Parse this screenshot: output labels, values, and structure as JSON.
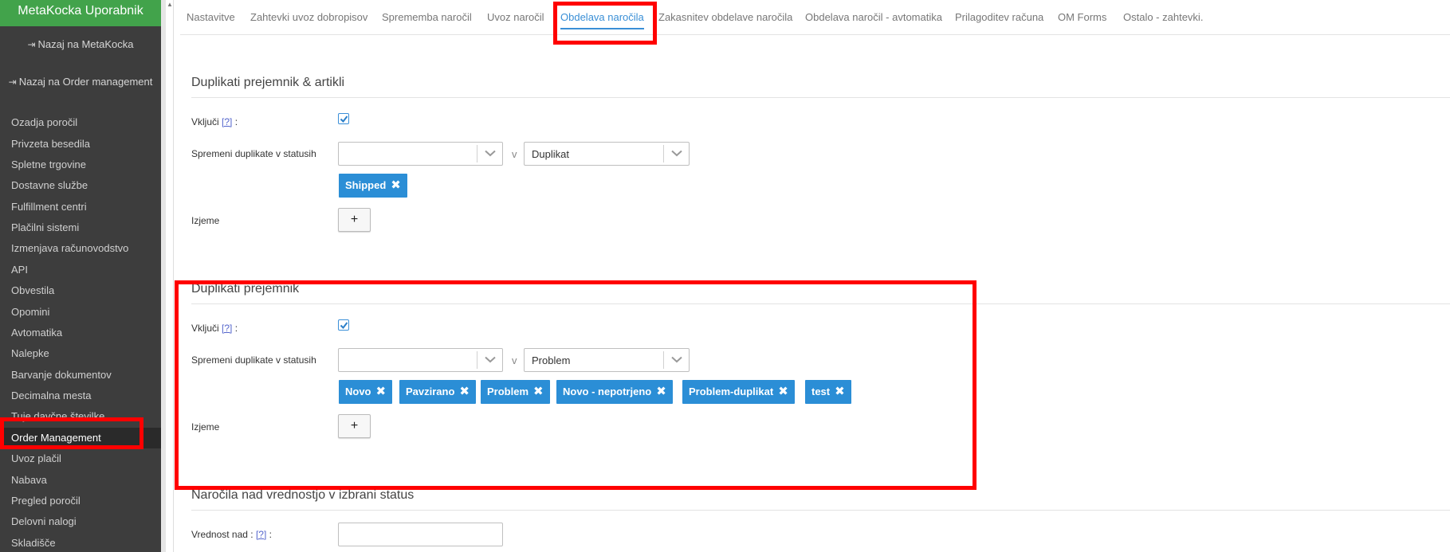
{
  "sidebar": {
    "title": "MetaKocka Uporabnik",
    "back_links": [
      "Nazaj na MetaKocka",
      "Nazaj na Order management"
    ],
    "items": [
      "Ozadja poročil",
      "Privzeta besedila",
      "Spletne trgovine",
      "Dostavne službe",
      "Fulfillment centri",
      "Plačilni sistemi",
      "Izmenjava računovodstvo",
      "API",
      "Obvestila",
      "Opomini",
      "Avtomatika",
      "Nalepke",
      "Barvanje dokumentov",
      "Decimalna mesta",
      "Tuje davčne številke",
      "Order Management",
      "Uvoz plačil",
      "Nabava",
      "Pregled poročil",
      "Delovni nalogi",
      "Skladišče"
    ],
    "active_item": "Order Management"
  },
  "tabs": [
    "Nastavitve",
    "Zahtevki uvoz dobropisov",
    "Sprememba naročil",
    "Uvoz naročil",
    "Obdelava naročila",
    "Zakasnitev obdelave naročila",
    "Obdelava naročil - avtomatika",
    "Prilagoditev računa",
    "OM Forms",
    "Ostalo - zahtevki."
  ],
  "active_tab": "Obdelava naročila",
  "sections": [
    {
      "title": "Duplikati prejemnik & artikli",
      "enable_label": "Vključi",
      "help": "[?]",
      "colon": ":",
      "enabled": true,
      "change_label": "Spremeni duplikate v statusih",
      "from_value": "",
      "v": "v",
      "to_value": "Duplikat",
      "tags": [
        "Shipped"
      ],
      "exceptions_label": "Izjeme",
      "add_label": "+"
    },
    {
      "title": "Duplikati prejemnik",
      "enable_label": "Vključi",
      "help": "[?]",
      "colon": ":",
      "enabled": true,
      "change_label": "Spremeni duplikate v statusih",
      "from_value": "",
      "v": "v",
      "to_value": "Problem",
      "tags": [
        "Novo",
        "Pavzirano",
        "Problem",
        "Novo - nepotrjeno",
        "Problem-duplikat",
        "test"
      ],
      "exceptions_label": "Izjeme",
      "add_label": "+"
    },
    {
      "title": "Naročila nad vrednostjo v izbrani status",
      "value_label": "Vrednost nad :",
      "help": "[?]",
      "colon": ":",
      "value": ""
    }
  ],
  "icons": {
    "back_link": "sign-out-icon",
    "chevron": "chevron-down-icon",
    "check": "check-icon",
    "remove": "close-icon"
  },
  "colors": {
    "sidebar_header": "#42a34b",
    "sidebar_bg": "#3d3d3d",
    "accent": "#2b8ed6",
    "highlight": "#ff0000"
  }
}
